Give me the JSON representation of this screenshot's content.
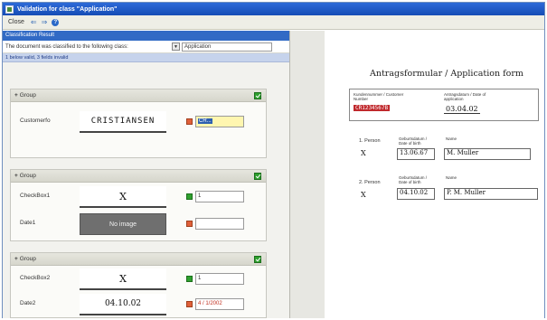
{
  "window": {
    "title": "Validation for class \"Application\""
  },
  "toolbar": {
    "close_label": "Close",
    "back_icon": "back-arrow-icon",
    "forward_icon": "forward-arrow-icon",
    "help_icon": "help-icon"
  },
  "classification": {
    "header": "Classification Result",
    "text": "The document was classified to the following class:",
    "class_value": "Application",
    "status": "1 below valid, 3 fields invalid"
  },
  "groups": [
    {
      "title": "Group",
      "fields": [
        {
          "label": "Customerfo",
          "snippet": "CRISTIANSEN",
          "value": "CR..."
        }
      ]
    },
    {
      "title": "Group",
      "fields": [
        {
          "label": "CheckBox1",
          "snippet": "X",
          "value": "1"
        },
        {
          "label": "Date1",
          "snippet": "No image",
          "value": ""
        }
      ]
    },
    {
      "title": "Group",
      "fields": [
        {
          "label": "CheckBox2",
          "snippet": "X",
          "value": "1"
        },
        {
          "label": "Date2",
          "snippet": "04.10.02",
          "value": "4 / 1/2002"
        }
      ]
    }
  ],
  "document": {
    "title": "Antragsformular / Application form",
    "customer_label": "Kundennummer / Customer Number",
    "customer_value": "CR1234567B",
    "date_label": "Antragsdatum / Date of application",
    "date_value": "03.04.02",
    "persons": [
      {
        "label": "1. Person",
        "birth_label": "Geburtsdatum / Date of birth",
        "birth": "13.06.67",
        "name_label": "Name",
        "name": "M. Muller",
        "check": "X"
      },
      {
        "label": "2. Person",
        "birth_label": "Geburtsdatum / Date of birth",
        "birth": "04.10.02",
        "name_label": "Name",
        "name": "P. M. Muller",
        "check": "X"
      }
    ]
  },
  "colors": {
    "titlebar": "#1f5ac6",
    "status_ok": "#2fa02f",
    "status_error": "#e0603a",
    "highlight": "#316ac5"
  }
}
